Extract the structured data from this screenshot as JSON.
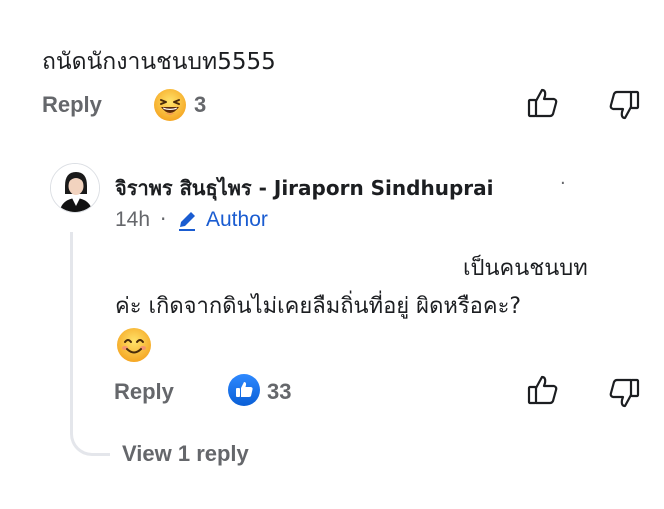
{
  "top_comment": {
    "text": "ถนัดนักงานชนบท5555",
    "reply_label": "Reply",
    "reaction_count": "3",
    "reaction_icon": "laughing-emoji-icon"
  },
  "reply": {
    "author": "จิราพร สินธุไพร - Jiraporn Sindhuprai",
    "time": "14h",
    "badge": "Author",
    "body_line1": "เป็นคนชนบท",
    "body_line2": "ค่ะ เกิดจากดินไม่เคยลืมถิ่นที่อยู่ ผิดหรือคะ?",
    "body_emoji": "smiling-emoji-icon",
    "reply_label": "Reply",
    "reaction_count": "33",
    "reaction_icon": "like-icon"
  },
  "view_replies": "View 1 reply",
  "colors": {
    "muted": "#65676b",
    "accent": "#1a5cd1",
    "like_blue": "#1877f2",
    "emoji_yellow": "#f7b928"
  }
}
